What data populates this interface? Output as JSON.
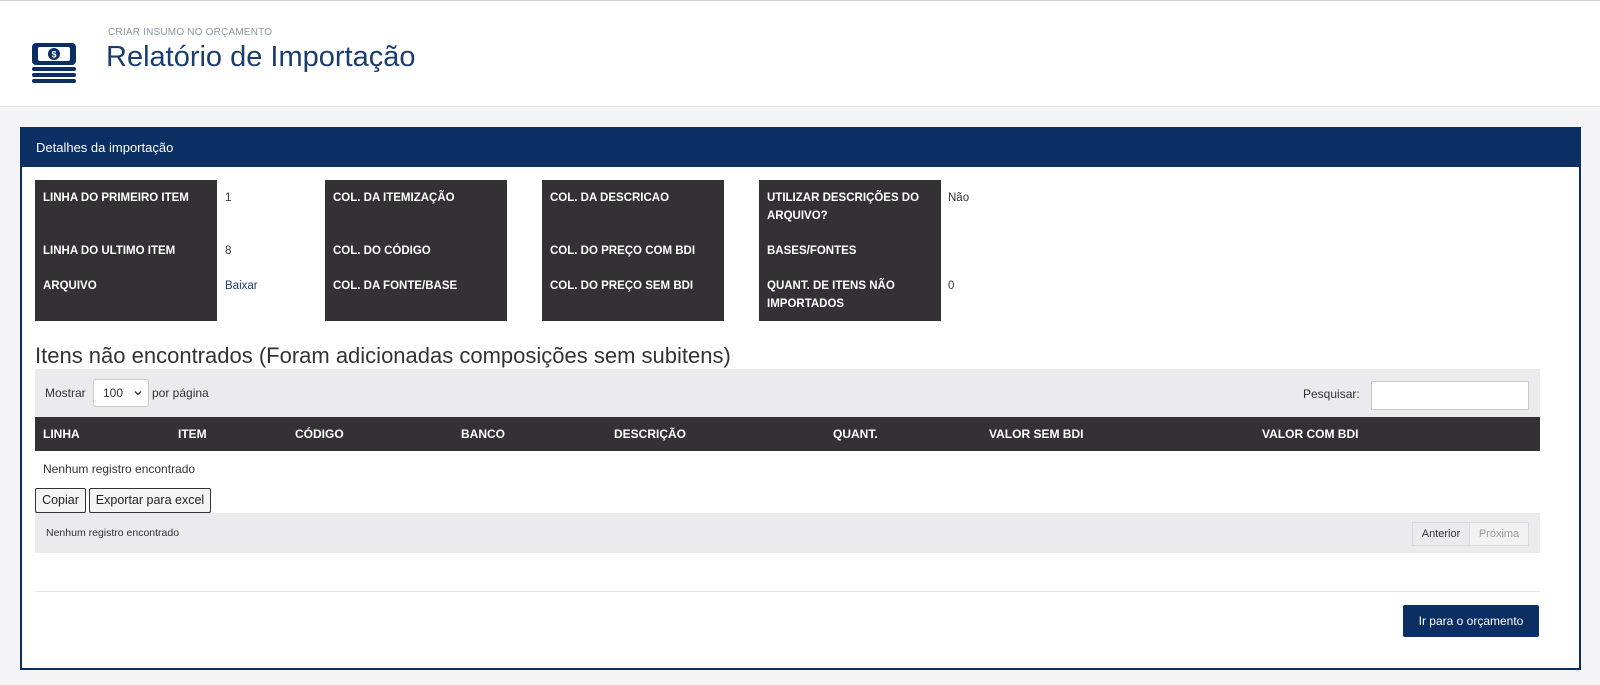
{
  "header": {
    "breadcrumb": "CRIAR INSUMO NO ORÇAMENTO",
    "title": "Relatório de Importação",
    "icon": "money-stack-icon"
  },
  "panel": {
    "title": "Detalhes da importação"
  },
  "details": {
    "col1": [
      {
        "label": "LINHA DO PRIMEIRO ITEM",
        "value": "1"
      },
      {
        "label": "LINHA DO ULTIMO ITEM",
        "value": "8"
      },
      {
        "label": "ARQUIVO",
        "value": "Baixar"
      }
    ],
    "col2": [
      {
        "label": "COL. DA ITEMIZAÇÃO",
        "value": ""
      },
      {
        "label": "COL. DO CÓDIGO",
        "value": ""
      },
      {
        "label": "COL. DA FONTE/BASE",
        "value": ""
      }
    ],
    "col3": [
      {
        "label": "COL. DA DESCRICAO",
        "value": ""
      },
      {
        "label": "COL. DO PREÇO COM BDI",
        "value": ""
      },
      {
        "label": "COL. DO PREÇO SEM BDI",
        "value": ""
      }
    ],
    "col4": [
      {
        "label_line1": "UTILIZAR DESCRIÇÕES DO",
        "label_line2": "ARQUIVO?",
        "value": "Não"
      },
      {
        "label_line1": "BASES/FONTES",
        "value": ""
      },
      {
        "label_line1": "QUANT. DE ITENS NÃO",
        "label_line2": "IMPORTADOS",
        "value": "0"
      }
    ]
  },
  "section_title": "Itens não encontrados (Foram adicionadas composições sem subitens)",
  "table": {
    "length_label": "Mostrar",
    "length_value": "100",
    "length_post": "por página",
    "search_label": "Pesquisar:",
    "search_value": "",
    "columns": [
      "LINHA",
      "ITEM",
      "CÓDIGO",
      "BANCO",
      "DESCRIÇÃO",
      "QUANT.",
      "VALOR SEM BDI",
      "VALOR COM BDI"
    ],
    "empty_text": "Nenhum registro encontrado",
    "info_text": "Nenhum registro encontrado",
    "copy_label": "Copiar",
    "export_label": "Exportar para excel",
    "prev_label": "Anterior",
    "next_label": "Próxima"
  },
  "go_button": "Ir para o orçamento",
  "colors": {
    "navy": "#0b2e63",
    "label_bg": "#333133",
    "link": "#1b3d6e"
  }
}
